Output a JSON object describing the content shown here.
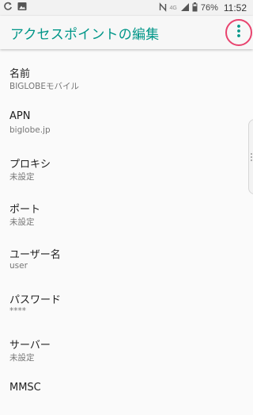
{
  "status_bar": {
    "icons": [
      "sync-icon",
      "image-icon",
      "nfc-icon",
      "signal-icon",
      "battery-icon"
    ],
    "network_type": "4G",
    "battery_percent": "76%",
    "time": "11:52"
  },
  "app_bar": {
    "title": "アクセスポイントの編集",
    "title_color": "#009688",
    "menu_icon": "more-vert-icon",
    "highlight_color": "#e8436e"
  },
  "settings": [
    {
      "title": "名前",
      "summary": "BIGLOBEモバイル"
    },
    {
      "title": "APN",
      "summary": "biglobe.jp"
    },
    {
      "title": "プロキシ",
      "summary": "未設定"
    },
    {
      "title": "ポート",
      "summary": "未設定"
    },
    {
      "title": "ユーザー名",
      "summary": "user"
    },
    {
      "title": "パスワード",
      "summary": "****"
    },
    {
      "title": "サーバー",
      "summary": "未設定"
    },
    {
      "title": "MMSC",
      "summary": ""
    }
  ]
}
